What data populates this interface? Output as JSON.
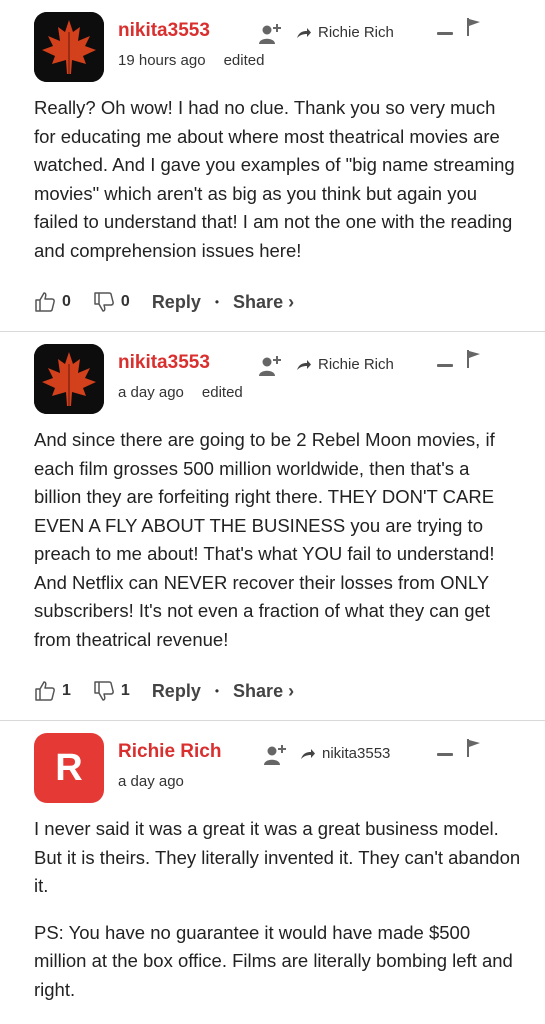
{
  "comments": [
    {
      "username": "nikita3553",
      "reply_to": "Richie Rich",
      "time": "19 hours ago",
      "edited": "edited",
      "avatar": "maple-leaf",
      "paragraphs": [
        "Really? Oh wow! I had no clue. Thank you so very much for educating me about where most theatrical movies are watched. And I gave you examples of \"big name streaming movies\" which aren't as big as you think but again you failed to understand that! I am not the one with the reading and comprehension issues here!"
      ],
      "likes": "0",
      "dislikes": "0"
    },
    {
      "username": "nikita3553",
      "reply_to": "Richie Rich",
      "time": "a day ago",
      "edited": "edited",
      "avatar": "maple-leaf",
      "paragraphs": [
        "And since there are going to be 2 Rebel Moon movies, if each film grosses 500 million worldwide, then that's a billion they are forfeiting right there. THEY DON'T CARE EVEN A FLY ABOUT THE BUSINESS you are trying to preach to me about! That's what YOU fail to understand! And Netflix can NEVER recover their losses from ONLY subscribers! It's not even a fraction of what they can get from theatrical revenue!"
      ],
      "likes": "1",
      "dislikes": "1"
    },
    {
      "username": "Richie Rich",
      "reply_to": "nikita3553",
      "time": "a day ago",
      "avatar_letter": "R",
      "paragraphs": [
        "I never said it was a great it was a great business model. But it is theirs. They literally invented it. They can't abandon it.",
        "PS: You have no guarantee it would have made $500 million at the box office. Films are literally bombing left and right."
      ]
    }
  ],
  "labels": {
    "reply": "Reply",
    "share": "Share ›",
    "dot": "•"
  },
  "colors": {
    "username": "#d9302f",
    "avatar_r": "#e53935"
  }
}
